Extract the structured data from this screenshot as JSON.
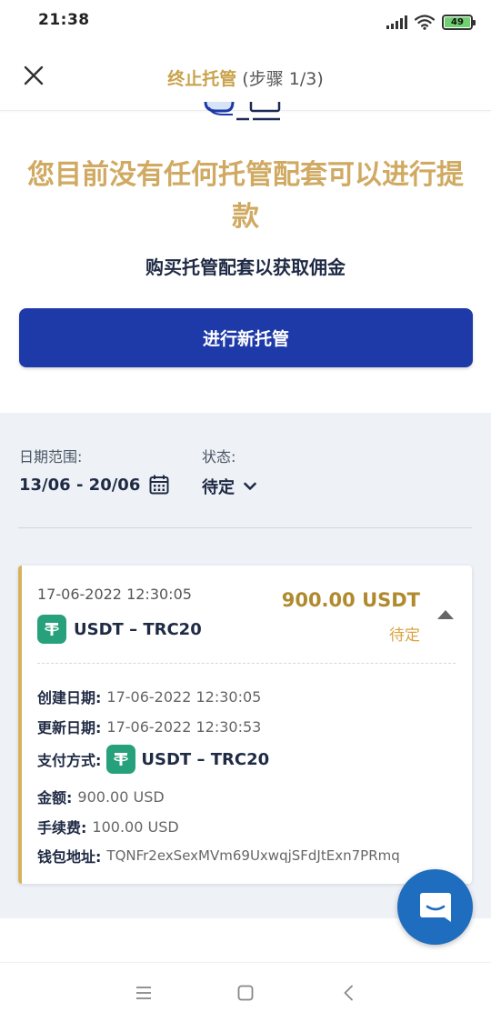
{
  "status_bar": {
    "time": "21:38",
    "battery": "49",
    "icons": [
      "signal-icon",
      "wifi-icon",
      "battery-icon"
    ]
  },
  "header": {
    "title": "终止托管",
    "step": "(步骤 1/3)",
    "close_icon": "close-icon"
  },
  "empty_state": {
    "title": "您目前没有任何托管配套可以进行提款",
    "subtitle": "购买托管配套以获取佣金",
    "button_label": "进行新托管"
  },
  "filters": {
    "date_label": "日期范围:",
    "date_value": "13/06 - 20/06",
    "status_label": "状态:",
    "status_value": "待定"
  },
  "transaction": {
    "date": "17-06-2022 12:30:05",
    "coin": "USDT – TRC20",
    "amount": "900.00 USDT",
    "status": "待定",
    "details": {
      "created_label": "创建日期:",
      "created_value": "17-06-2022 12:30:05",
      "updated_label": "更新日期:",
      "updated_value": "17-06-2022 12:30:53",
      "payment_label": "支付方式:",
      "payment_value": "USDT – TRC20",
      "amount_label": "金额:",
      "amount_value": "900.00 USD",
      "fee_label": "手续费:",
      "fee_value": "100.00 USD",
      "wallet_label": "钱包地址:",
      "wallet_value": "TQNFr2exSexMVm69UxwqjSFdJtExn7PRmq"
    }
  },
  "colors": {
    "primary": "#1e3aa8",
    "gold": "#d0aa62",
    "amount": "#b08a2e",
    "tether": "#26a17b",
    "chat": "#1e6dbf"
  }
}
